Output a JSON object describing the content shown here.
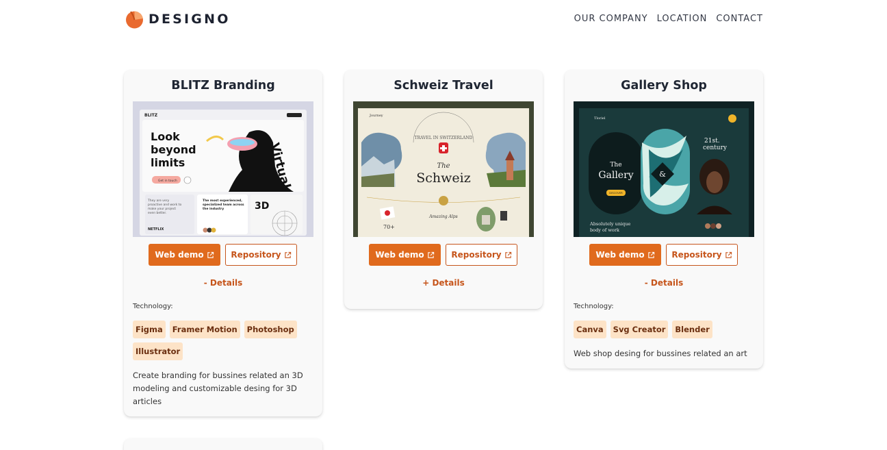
{
  "brand": {
    "name": "DESIGNO",
    "accent": "#e06a1d"
  },
  "nav": {
    "items": [
      "OUR COMPANY",
      "LOCATION",
      "CONTACT"
    ]
  },
  "projects": [
    {
      "title": "BLITZ Branding",
      "web_demo": "Web demo",
      "repository": "Repository",
      "details_toggle": "- Details",
      "tech_label": "Technology:",
      "tech": [
        "Figma",
        "Framer Motion",
        "Photoshop",
        "Illustrator"
      ],
      "description": "Create branding for bussines related an 3D modeling and customizable desing for 3D articles",
      "thumb": {
        "brand": "BLITZ",
        "headline": [
          "Look",
          "beyond",
          "limits"
        ],
        "cta": "Get in touch",
        "side_text": [
          "They are very",
          "proactive and work to",
          "make your project",
          "even better."
        ],
        "quote": [
          "The most experienced,",
          "specialized team across",
          "the industry"
        ],
        "label_3d": "3D",
        "client": "NETFLIX",
        "virtual": "Virtual"
      }
    },
    {
      "title": "Schweiz Travel",
      "web_demo": "Web demo",
      "repository": "Repository",
      "details_toggle": "+ Details",
      "thumb": {
        "brand": "Journey",
        "arc_text": "TRAVEL IN SWITZERLAND",
        "the": "The",
        "name": "Schweiz",
        "caption": "Amazing Alps",
        "stat": "70+"
      }
    },
    {
      "title": "Gallery Shop",
      "web_demo": "Web demo",
      "repository": "Repository",
      "details_toggle": "- Details",
      "tech_label": "Technology:",
      "tech": [
        "Canva",
        "Svg Creator",
        "Blender"
      ],
      "description": "Web shop desing for bussines related an art",
      "thumb": {
        "brand": "Tloriel",
        "the": "The",
        "name": "Gallery",
        "amp": "&",
        "century": [
          "21st.",
          "century"
        ],
        "tagline": [
          "Absolutely unique",
          "body of work"
        ],
        "button": "DISCOVER"
      }
    }
  ]
}
